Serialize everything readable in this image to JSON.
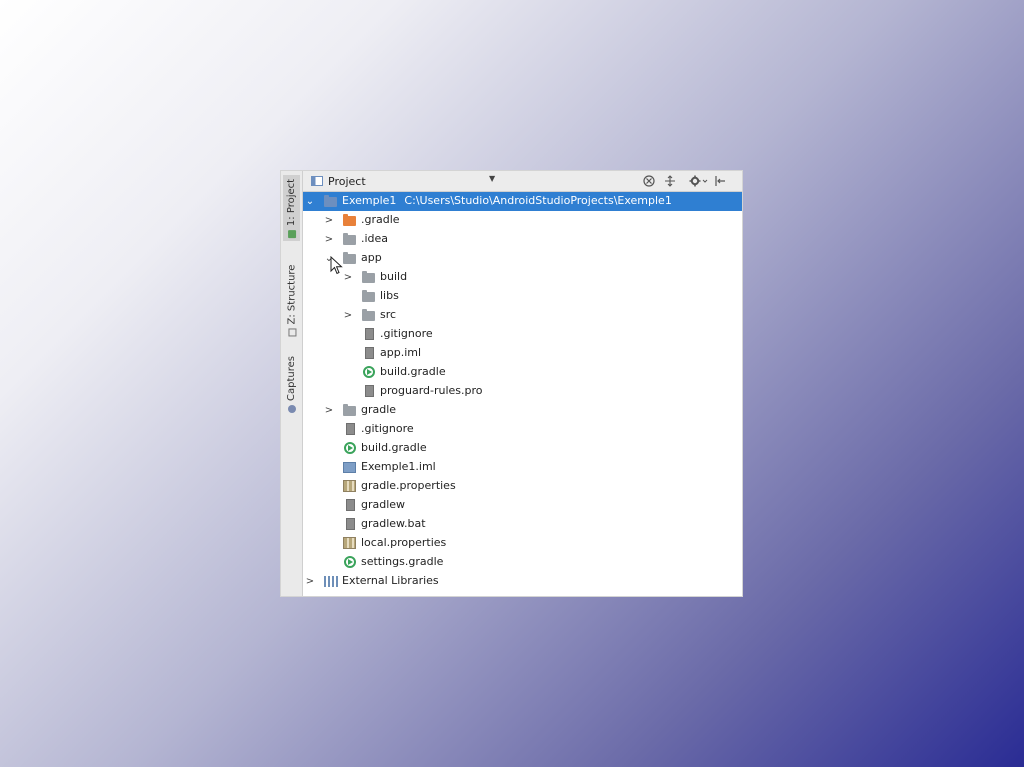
{
  "header": {
    "title": "Project",
    "dropdown_icon": "triangle-down",
    "buttons": [
      "scroll-from-source-icon",
      "collapse-all-icon",
      "settings-gear-icon",
      "hide-panel-icon"
    ]
  },
  "side_tabs": [
    {
      "label": "1: Project",
      "active": true
    },
    {
      "label": "Z: Structure",
      "active": false
    },
    {
      "label": "Captures",
      "active": false
    }
  ],
  "tree": [
    {
      "label": "Exemple1",
      "path": "C:\\Users\\Studio\\AndroidStudioProjects\\Exemple1",
      "depth": 0,
      "arrow": "open",
      "icon": "project-folder-icon",
      "selected": true
    },
    {
      "label": ".gradle",
      "depth": 1,
      "arrow": "closed",
      "icon": "folder-orange-icon"
    },
    {
      "label": ".idea",
      "depth": 1,
      "arrow": "closed",
      "icon": "folder-icon"
    },
    {
      "label": "app",
      "depth": 1,
      "arrow": "open",
      "icon": "module-folder-icon"
    },
    {
      "label": "build",
      "depth": 2,
      "arrow": "closed",
      "icon": "folder-icon"
    },
    {
      "label": "libs",
      "depth": 2,
      "arrow": "none",
      "icon": "folder-icon"
    },
    {
      "label": "src",
      "depth": 2,
      "arrow": "closed",
      "icon": "folder-icon"
    },
    {
      "label": ".gitignore",
      "depth": 2,
      "arrow": "none",
      "icon": "text-file-icon"
    },
    {
      "label": "app.iml",
      "depth": 2,
      "arrow": "none",
      "icon": "text-file-icon"
    },
    {
      "label": "build.gradle",
      "depth": 2,
      "arrow": "none",
      "icon": "gradle-file-icon"
    },
    {
      "label": "proguard-rules.pro",
      "depth": 2,
      "arrow": "none",
      "icon": "text-file-icon"
    },
    {
      "label": "gradle",
      "depth": 1,
      "arrow": "closed",
      "icon": "folder-icon"
    },
    {
      "label": ".gitignore",
      "depth": 1,
      "arrow": "none",
      "icon": "text-file-icon"
    },
    {
      "label": "build.gradle",
      "depth": 1,
      "arrow": "none",
      "icon": "gradle-file-icon"
    },
    {
      "label": "Exemple1.iml",
      "depth": 1,
      "arrow": "none",
      "icon": "iml-file-icon"
    },
    {
      "label": "gradle.properties",
      "depth": 1,
      "arrow": "none",
      "icon": "properties-file-icon"
    },
    {
      "label": "gradlew",
      "depth": 1,
      "arrow": "none",
      "icon": "text-file-icon"
    },
    {
      "label": "gradlew.bat",
      "depth": 1,
      "arrow": "none",
      "icon": "text-file-icon"
    },
    {
      "label": "local.properties",
      "depth": 1,
      "arrow": "none",
      "icon": "properties-file-icon"
    },
    {
      "label": "settings.gradle",
      "depth": 1,
      "arrow": "none",
      "icon": "gradle-file-icon"
    },
    {
      "label": "External Libraries",
      "depth": 0,
      "arrow": "closed",
      "icon": "external-libraries-icon"
    }
  ],
  "colors": {
    "selection": "#2f7fd2",
    "folder": "#9aa0a6",
    "gradle_folder": "#e8813a",
    "gradle_icon": "#3aa35b"
  }
}
